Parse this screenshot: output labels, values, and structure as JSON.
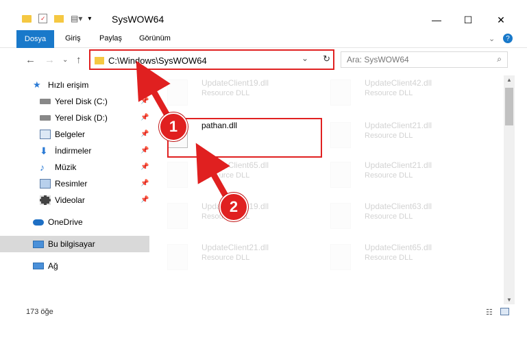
{
  "window": {
    "title": "SysWOW64"
  },
  "ribbon": {
    "tabs": [
      "Dosya",
      "Giriş",
      "Paylaş",
      "Görünüm"
    ]
  },
  "address": {
    "path": "C:\\Windows\\SysWOW64",
    "search_placeholder": "Ara: SysWOW64"
  },
  "nav": {
    "items": [
      {
        "label": "Hızlı erişim",
        "icon": "star-icon"
      },
      {
        "label": "Yerel Disk (C:)",
        "icon": "drive-icon"
      },
      {
        "label": "Yerel Disk (D:)",
        "icon": "drive-icon"
      },
      {
        "label": "Belgeler",
        "icon": "documents-icon"
      },
      {
        "label": "İndirmeler",
        "icon": "download-icon"
      },
      {
        "label": "Müzik",
        "icon": "music-icon"
      },
      {
        "label": "Resimler",
        "icon": "pictures-icon"
      },
      {
        "label": "Videolar",
        "icon": "video-icon"
      },
      {
        "label": "OneDrive",
        "icon": "cloud-icon"
      },
      {
        "label": "Bu bilgisayar",
        "icon": "computer-icon"
      },
      {
        "label": "Ağ",
        "icon": "network-icon"
      }
    ]
  },
  "files": {
    "left": [
      {
        "name": "UpdateClient19.dll",
        "type": "Resource DLL"
      },
      {
        "name": "pathan.dll",
        "type": ""
      },
      {
        "name": "UpdateClient65.dll",
        "type": "Resource DLL"
      },
      {
        "name": "UpdateClient19.dll",
        "type": "Resource DLL"
      },
      {
        "name": "UpdateClient21.dll",
        "type": "Resource DLL"
      }
    ],
    "right": [
      {
        "name": "UpdateClient42.dll",
        "type": "Resource DLL"
      },
      {
        "name": "UpdateClient21.dll",
        "type": "Resource DLL"
      },
      {
        "name": "UpdateClient21.dll",
        "type": "Resource DLL"
      },
      {
        "name": "UpdateClient63.dll",
        "type": "Resource DLL"
      },
      {
        "name": "UpdateClient65.dll",
        "type": "Resource DLL"
      }
    ]
  },
  "status": {
    "count": "173 öğe"
  },
  "annotations": {
    "step1": "1",
    "step2": "2"
  },
  "colors": {
    "accent": "#1979ca",
    "highlight": "#e02020"
  }
}
